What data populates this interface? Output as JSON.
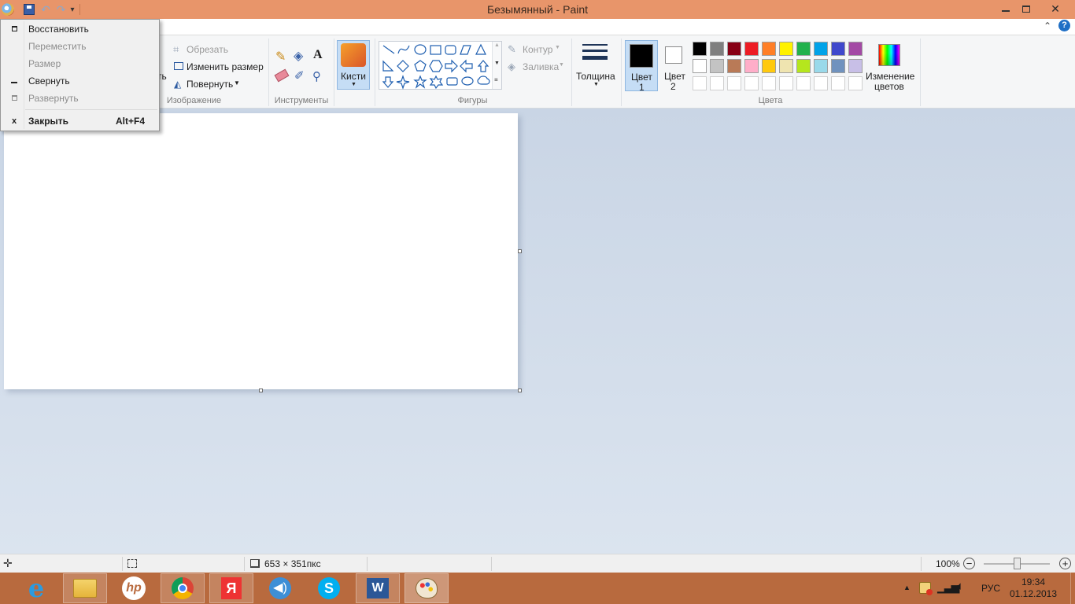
{
  "window": {
    "title": "Безымянный - Paint"
  },
  "sysmenu": {
    "items": [
      {
        "label": "Восстановить",
        "icon": "restore-icon",
        "enabled": true
      },
      {
        "label": "Переместить",
        "icon": "",
        "enabled": false
      },
      {
        "label": "Размер",
        "icon": "",
        "enabled": false
      },
      {
        "label": "Свернуть",
        "icon": "minimize-icon",
        "enabled": true
      },
      {
        "label": "Развернуть",
        "icon": "maximize-icon",
        "enabled": false
      },
      {
        "label": "Закрыть",
        "icon": "close-icon",
        "enabled": true,
        "shortcut": "Alt+F4"
      }
    ]
  },
  "ribbon": {
    "image_group": {
      "partial_text": "ть",
      "crop": "Обрезать",
      "resize": "Изменить размер",
      "rotate": "Повернуть",
      "label": "Изображение"
    },
    "tools_group": {
      "label": "Инструменты"
    },
    "brushes": {
      "label": "Кисти"
    },
    "shapes_group": {
      "outline": "Контур",
      "fill": "Заливка",
      "label": "Фигуры"
    },
    "size": {
      "label": "Толщина"
    },
    "color1": {
      "label_line1": "Цвет",
      "label_line2": "1",
      "value": "#000000"
    },
    "color2": {
      "label_line1": "Цвет",
      "label_line2": "2",
      "value": "#ffffff"
    },
    "edit_colors": {
      "label_line1": "Изменение",
      "label_line2": "цветов"
    },
    "colors_group": {
      "label": "Цвета",
      "row1": [
        "#000000",
        "#7f7f7f",
        "#880015",
        "#ed1c24",
        "#ff7f27",
        "#fff200",
        "#22b14c",
        "#00a2e8",
        "#3f48cc",
        "#a349a4"
      ],
      "row2": [
        "#ffffff",
        "#c3c3c3",
        "#b97a57",
        "#ffaec9",
        "#ffc90e",
        "#efe4b0",
        "#b5e61d",
        "#99d9ea",
        "#7092be",
        "#c8bfe7"
      ]
    }
  },
  "status": {
    "canvas_size": "653 × 351пкс",
    "zoom": "100%"
  },
  "taskbar": {
    "apps": [
      "internet-explorer-icon",
      "file-explorer-icon",
      "hp-icon",
      "chrome-icon",
      "yandex-icon",
      "audio-app-icon",
      "skype-icon",
      "word-icon",
      "paint-icon"
    ],
    "language": "РУС",
    "time": "19:34",
    "date": "01.12.2013"
  }
}
